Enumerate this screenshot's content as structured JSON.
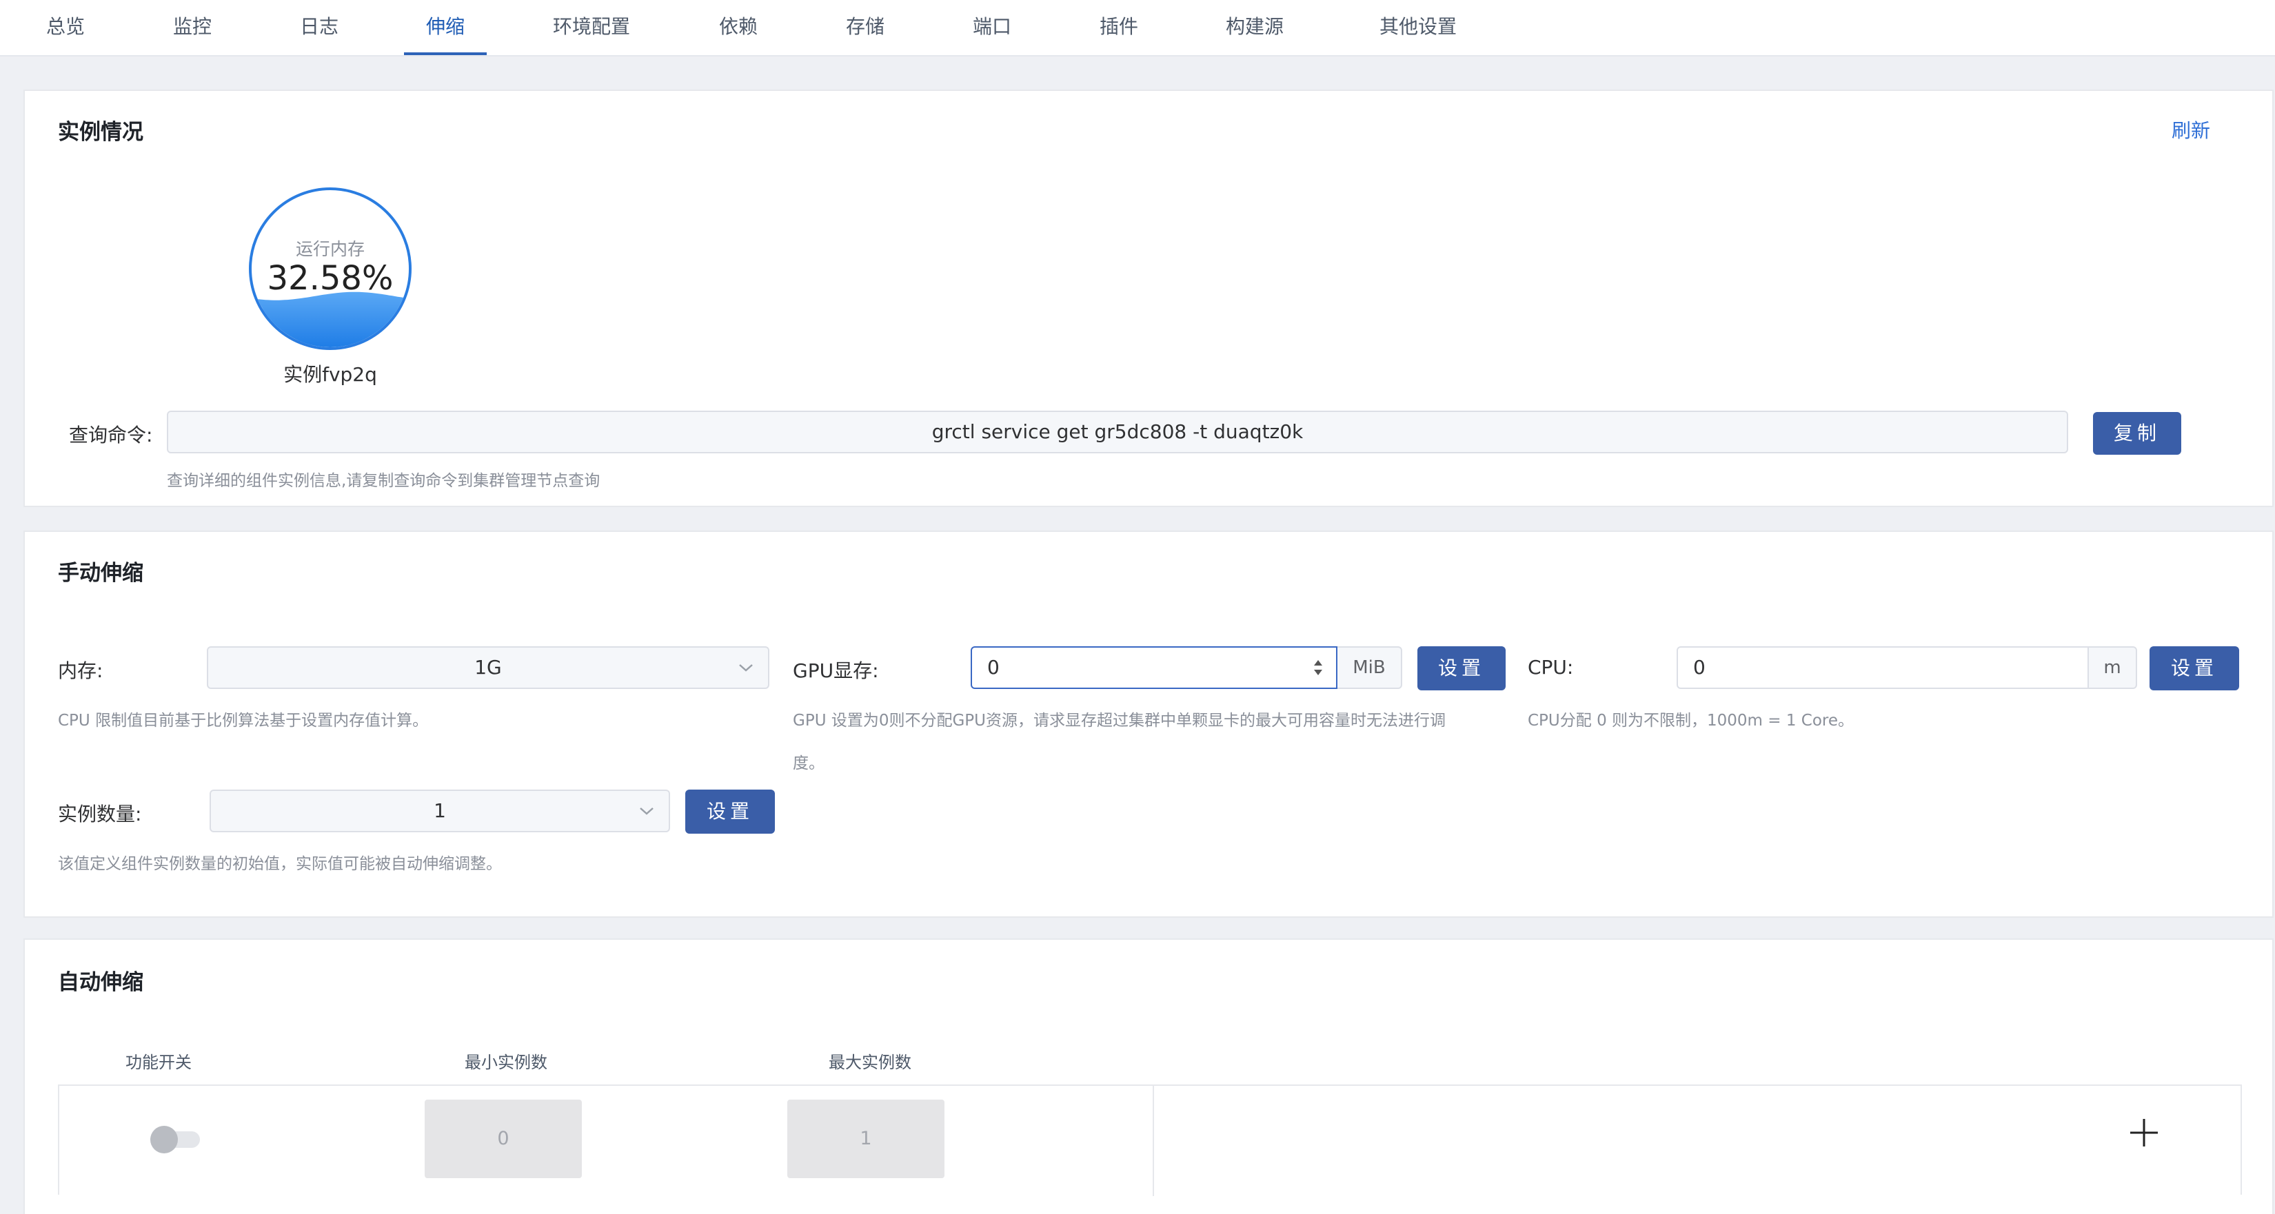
{
  "tabs": [
    {
      "label": "总览",
      "active": false
    },
    {
      "label": "监控",
      "active": false
    },
    {
      "label": "日志",
      "active": false
    },
    {
      "label": "伸缩",
      "active": true
    },
    {
      "label": "环境配置",
      "active": false
    },
    {
      "label": "依赖",
      "active": false
    },
    {
      "label": "存储",
      "active": false
    },
    {
      "label": "端口",
      "active": false
    },
    {
      "label": "插件",
      "active": false
    },
    {
      "label": "构建源",
      "active": false
    },
    {
      "label": "其他设置",
      "active": false
    }
  ],
  "instances": {
    "title": "实例情况",
    "refresh_label": "刷新",
    "gauge": {
      "label": "运行内存",
      "value_text": "32.58%",
      "fill_fraction": 0.3258
    },
    "instance_name": "实例fvp2q",
    "query": {
      "label": "查询命令:",
      "command": "grctl service get gr5dc808 -t duaqtz0k",
      "copy_label": "复制",
      "hint": "查询详细的组件实例信息,请复制查询命令到集群管理节点查询"
    }
  },
  "manual": {
    "title": "手动伸缩",
    "memory": {
      "label": "内存:",
      "value": "1G",
      "hint": "CPU 限制值目前基于比例算法基于设置内存值计算。"
    },
    "gpu": {
      "label": "GPU显存:",
      "value": "0",
      "unit": "MiB",
      "button": "设置",
      "hint_line1": "GPU 设置为0则不分配GPU资源，请求显存超过集群中单颗显卡的最大可用容量时无法进行调",
      "hint_line2": "度。"
    },
    "cpu": {
      "label": "CPU:",
      "value": "0",
      "unit": "m",
      "button": "设置",
      "hint": "CPU分配 0 则为不限制，1000m = 1 Core。"
    },
    "replicas": {
      "label": "实例数量:",
      "value": "1",
      "button": "设置",
      "hint": "该值定义组件实例数量的初始值，实际值可能被自动伸缩调整。"
    }
  },
  "auto": {
    "title": "自动伸缩",
    "columns": [
      "功能开关",
      "最小实例数",
      "最大实例数"
    ],
    "toggle_on": false,
    "min_replicas": "0",
    "max_replicas": "1"
  },
  "colors": {
    "accent": "#3a5ea8",
    "link": "#2f6fd6",
    "gauge": "#2a7de1"
  }
}
